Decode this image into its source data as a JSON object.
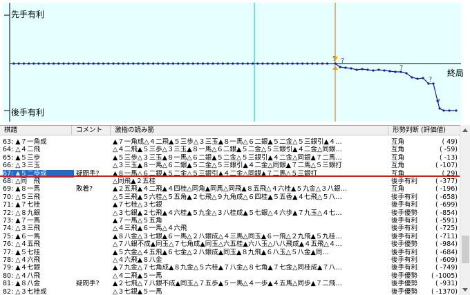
{
  "graph": {
    "label_top": "先手有利",
    "label_bottom": "後手有利",
    "label_end": "終局",
    "colors": {
      "bg": "#e6ffff",
      "line": "#1a1aa8",
      "cursor": "#c89650",
      "marker": "#18b4b4",
      "axis": "#000000"
    }
  },
  "table": {
    "headers": {
      "move": "棋譜",
      "comment": "コメント",
      "line": "激指の読み筋",
      "judge": "形勢判断 (評価値)"
    },
    "rows": [
      {
        "move": "63: ▲７一角成",
        "comment": "",
        "line": "▲７一角成△４二飛▲５三歩△３三玉▲８一馬△６二銀▲５二金△５三銀引▲４…",
        "judge": "互角",
        "score": "(      49)"
      },
      {
        "move": "64: △４二飛",
        "comment": "",
        "line": "△４二飛▲５三歩△３三玉▲８一馬△６二銀▲５二金△５三銀引▲４二金△同銀…",
        "judge": "互角",
        "score": "(     -59)"
      },
      {
        "move": "65: ▲５三歩",
        "comment": "",
        "line": "▲５三歩△３三玉▲８一馬△６二銀▲５二金△５三銀引▲４二金△同銀▲７二馬…",
        "judge": "互角",
        "score": "(     -13)"
      },
      {
        "move": "66: △３三玉",
        "comment": "",
        "line": "△３三玉▲８一馬△６二銀▲５二金△５三銀引▲４二金△同銀▲７二馬△５三銀打",
        "judge": "互角",
        "score": "(    -107)"
      },
      {
        "move": "67: ▲５二歩成",
        "comment": "疑問手?",
        "line": "▲８一馬△６二銀▲５二金△５三銀引▲４二金△同銀▲７二馬△５三銀打",
        "judge": "互角",
        "score": "(      29)"
      },
      {
        "move": "68: △同　飛",
        "comment": "",
        "line": "△同飛▲２五桂",
        "judge": "後手有利",
        "score": "(    -377)"
      },
      {
        "move": "69: ▲８一馬",
        "comment": "敗着?",
        "line": "▲２五飛▲４二飛▲４四桂△同角▲同馬△同飛▲８五飛△４六桂▲５九金△３八銀…",
        "judge": "互角",
        "score": "(    -196)"
      },
      {
        "move": "70: △５三飛",
        "comment": "",
        "line": "△５三飛▲５六桂△５五角▲２七飛△９九角成△６四桂▲５五香▲４七飛△５八…",
        "judge": "後手有利",
        "score": "(    -658)"
      },
      {
        "move": "71: ▲７七桂",
        "comment": "",
        "line": "▲７七桂△３七銀",
        "judge": "後手有利",
        "score": "(    -699)"
      },
      {
        "move": "72: △８九銀",
        "comment": "",
        "line": "△３七銀▲２七飛▲４六桂▲５九金△３八桂成▲５七銀△４六歩▲７九玉△４七…",
        "judge": "後手優勢",
        "score": "(    -854)"
      },
      {
        "move": "73: ▲７一馬",
        "comment": "",
        "line": "▲７一馬△５五角",
        "judge": "後手有利",
        "score": "(    -591)"
      },
      {
        "move": "74: △３三飛",
        "comment": "",
        "line": "△４三飛▲６一馬△４六飛",
        "judge": "後手有利",
        "score": "(    -725)"
      },
      {
        "move": "75: ▲６一馬",
        "comment": "",
        "line": "▲８八金△３七銀▲６一馬△２八銀成△４三馬△同玉▲６一飛△２九飛▲５九桂…",
        "judge": "後手有利",
        "score": "(    -711)"
      },
      {
        "move": "76: △４五飛",
        "comment": "",
        "line": "△７八銀不成▲同玉△７七角成▲同玉△六五桂▲六八玉△八八飛成▲４五飛△４…",
        "judge": "後手優勢",
        "score": "(    -984)"
      },
      {
        "move": "77: ▲５七桂",
        "comment": "",
        "line": "▲５六金△４五飛▲６七金△２八銀成▲同玉▲８九飛▲６八玉△５八金▲同…",
        "judge": "後手有利",
        "score": "(    -684)"
      },
      {
        "move": "78: △４六飛",
        "comment": "",
        "line": "△４六飛▲８八金",
        "judge": "後手有利",
        "score": "(    -609)"
      },
      {
        "move": "79: ▲４七銀",
        "comment": "",
        "line": "▲７九金△７七角成▲８九金△５六桂▲７八金△８七角▲７七金△同桂成▲７八…",
        "judge": "後手有利",
        "score": "(    -749)"
      },
      {
        "move": "80: △４八飛",
        "comment": "",
        "line": "△４二飛▲５一馬",
        "judge": "後手優勢",
        "score": "(   -1005)"
      },
      {
        "move": "81: ▲８八金",
        "comment": "疑問手?",
        "line": "▲２七飛△７八銀不成▲同玉△７五歩▲５一馬△４一歩▲４五馬△同歩▲７二飛…",
        "judge": "後手優勢",
        "score": "(    -931)"
      },
      {
        "move": "82: △３七桂成",
        "comment": "",
        "line": "△３七銀▲５一馬",
        "judge": "後手優勢",
        "score": "(   -1370)"
      }
    ]
  }
}
